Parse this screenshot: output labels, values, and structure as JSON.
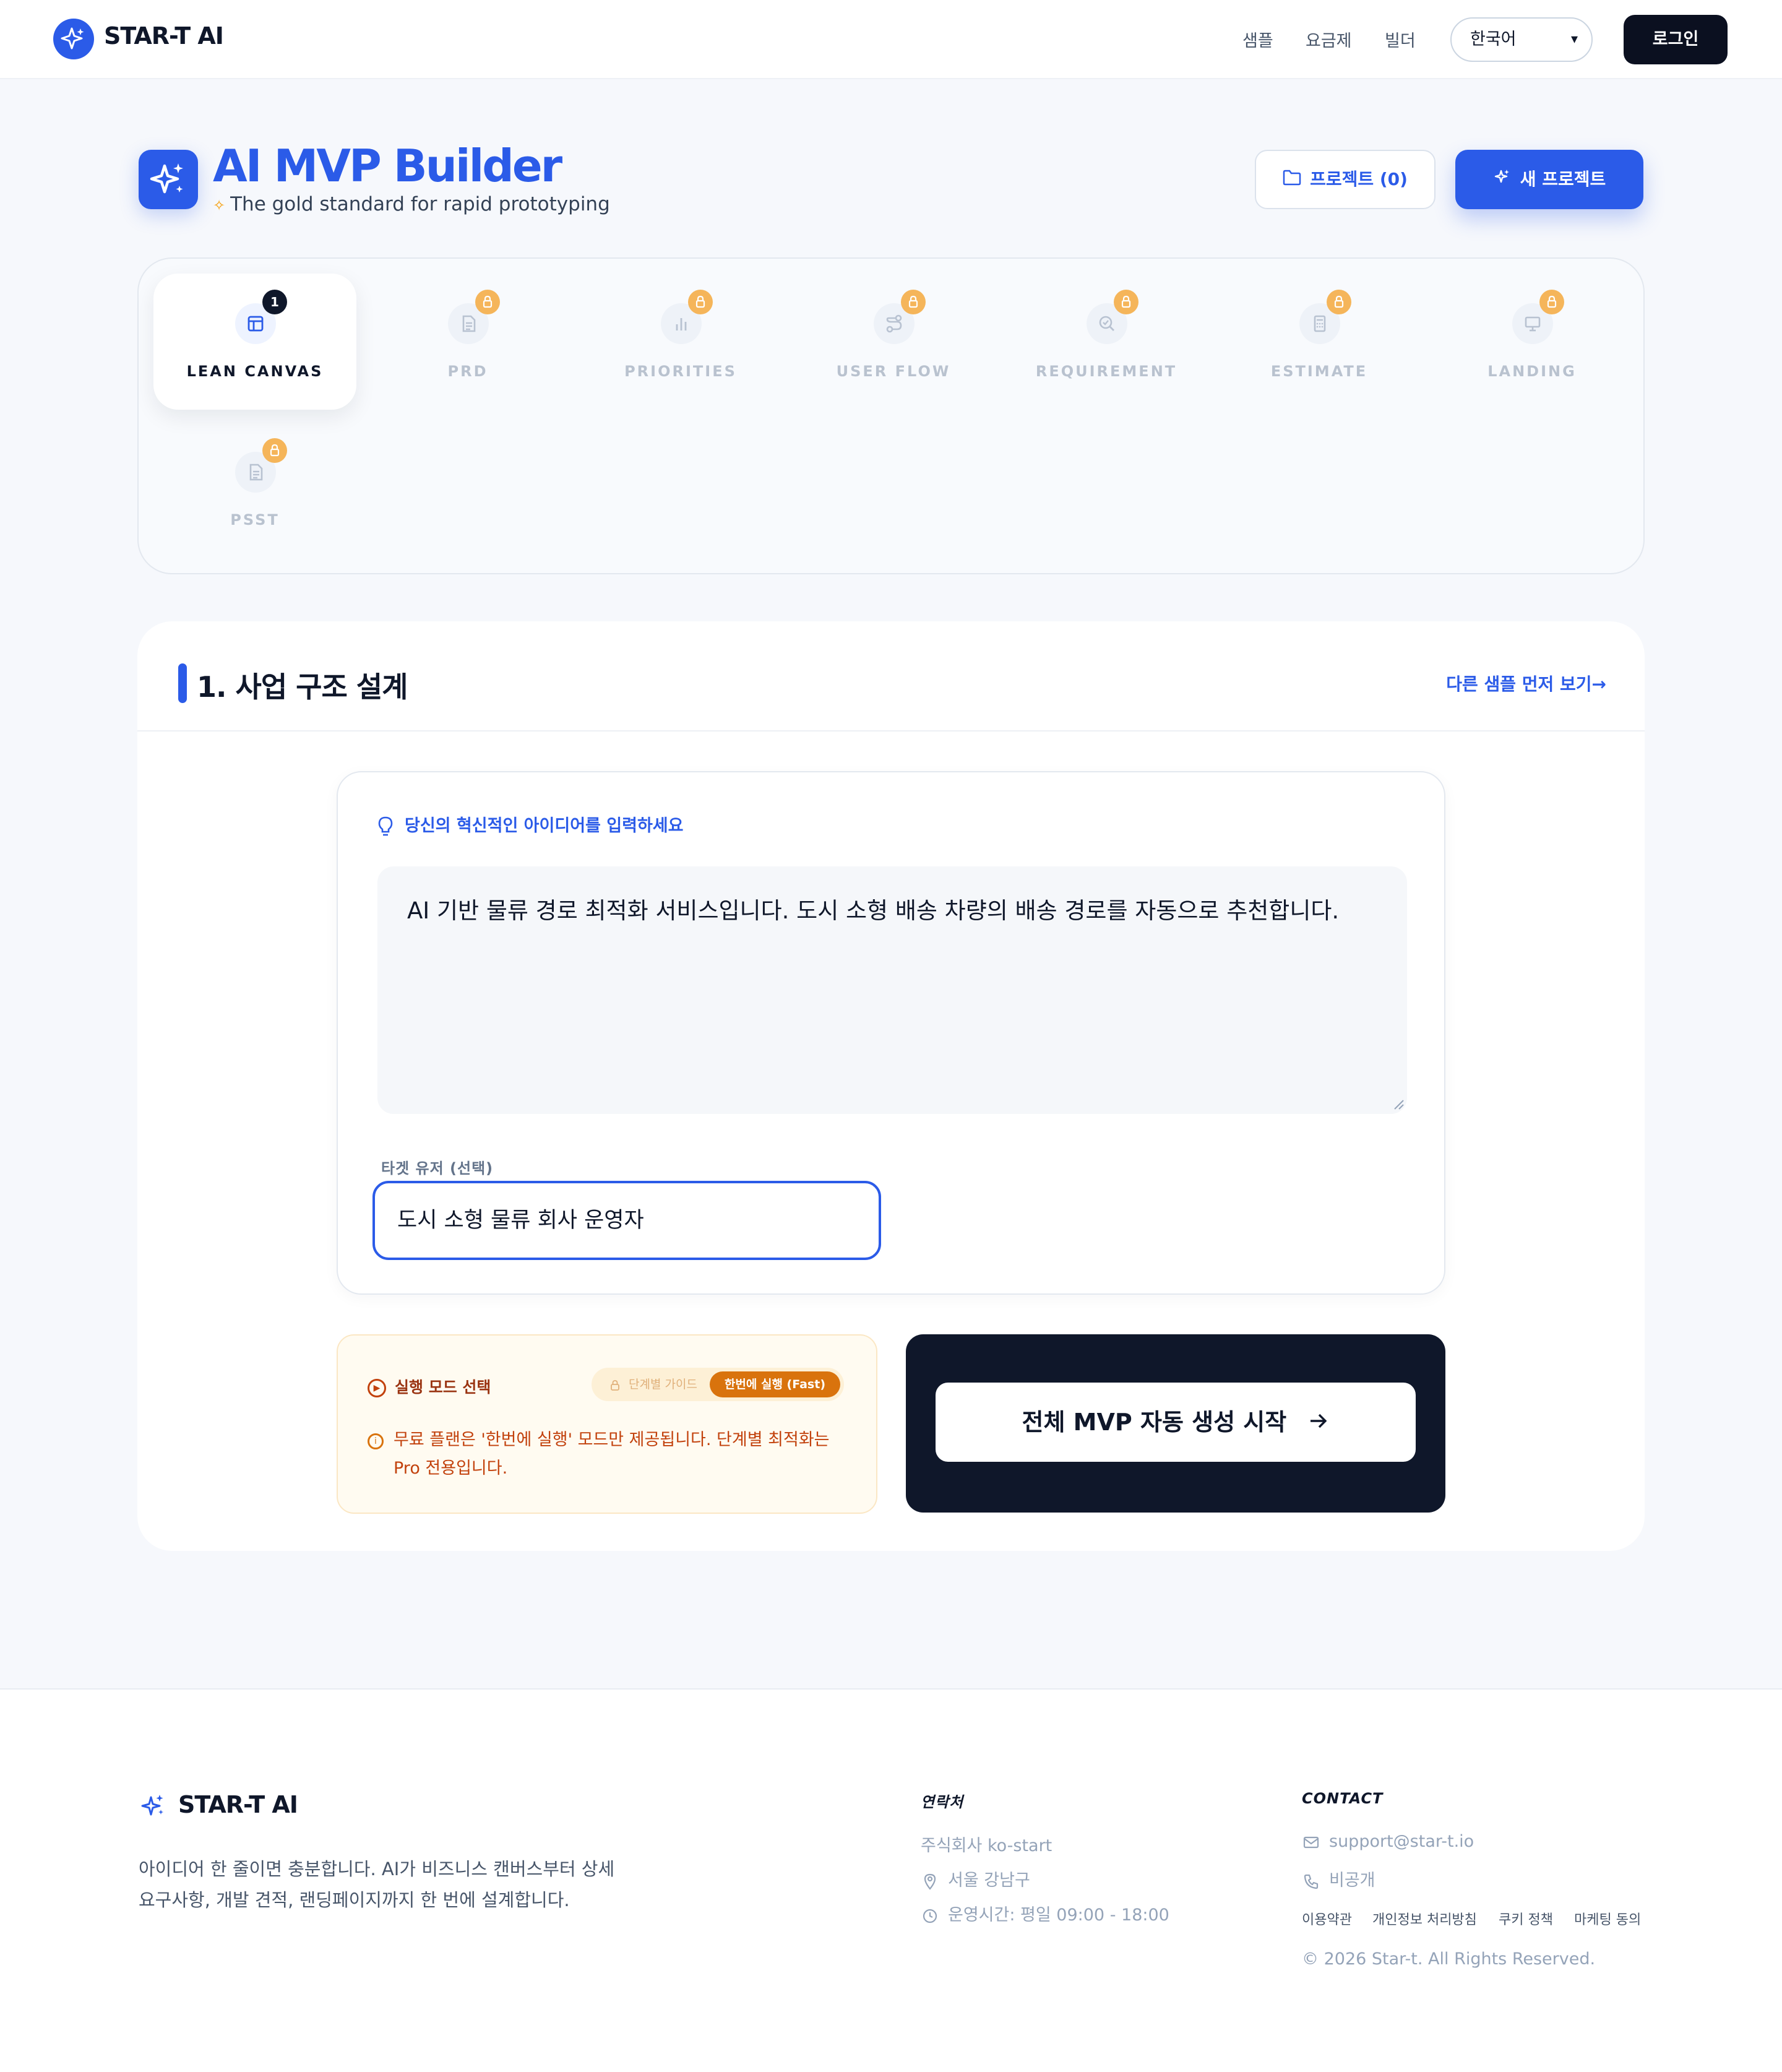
{
  "header": {
    "brand": "STAR-T AI",
    "nav": [
      "샘플",
      "요금제",
      "빌더"
    ],
    "language": "한국어",
    "login": "로그인"
  },
  "hero": {
    "title": "AI MVP Builder",
    "subtitle": "The gold standard for rapid prototyping",
    "projects_button": "프로젝트 (0)",
    "new_project_button": "새 프로젝트"
  },
  "steps": [
    {
      "label": "LEAN CANVAS",
      "badge": "1",
      "icon": "layout-icon",
      "active": true
    },
    {
      "label": "PRD",
      "badge": "lock",
      "icon": "document-icon",
      "active": false
    },
    {
      "label": "PRIORITIES",
      "badge": "lock",
      "icon": "bar-chart-icon",
      "active": false
    },
    {
      "label": "USER FLOW",
      "badge": "lock",
      "icon": "flow-icon",
      "active": false
    },
    {
      "label": "REQUIREMENT",
      "badge": "lock",
      "icon": "search-check-icon",
      "active": false
    },
    {
      "label": "ESTIMATE",
      "badge": "lock",
      "icon": "calculator-icon",
      "active": false
    },
    {
      "label": "LANDING",
      "badge": "lock",
      "icon": "monitor-icon",
      "active": false
    },
    {
      "label": "PSST",
      "badge": "lock",
      "icon": "document-icon",
      "active": false
    }
  ],
  "main": {
    "section_title": "1. 사업 구조 설계",
    "sample_link": "다른 샘플 먼저 보기→",
    "idea_label": "당신의 혁신적인 아이디어를 입력하세요",
    "idea_value": "AI 기반 물류 경로 최적화 서비스입니다. 도시 소형 배송 차량의 배송 경로를 자동으로 추천합니다.",
    "target_label": "타겟 유저 (선택)",
    "target_value": "도시 소형 물류 회사 운영자",
    "mode_title": "실행 모드 선택",
    "mode_option_guide": "단계별 가이드",
    "mode_option_fast": "한번에 실행 (Fast)",
    "mode_note": "무료 플랜은 '한번에 실행' 모드만 제공됩니다. 단계별 최적화는 Pro 전용입니다.",
    "run_button": "전체 MVP 자동 생성 시작"
  },
  "footer": {
    "brand": "STAR-T AI",
    "description": "아이디어 한 줄이면 충분합니다. AI가 비즈니스 캔버스부터 상세 요구사항, 개발 견적, 랜딩페이지까지 한 번에 설계합니다.",
    "contact_heading_kr": "연락처",
    "company": "주식회사 ko-start",
    "location": "서울 강남구",
    "hours": "운영시간: 평일 09:00 - 18:00",
    "contact_heading_en": "CONTACT",
    "email": "support@star-t.io",
    "phone": "비공개",
    "links": [
      "이용약관",
      "개인정보 처리방침",
      "쿠키 정책",
      "마케팅 동의"
    ],
    "copyright": "© 2026 Star-t. All Rights Reserved."
  },
  "colors": {
    "primary": "#2b5be8",
    "dark": "#0f172a",
    "lock": "#f5b55a",
    "warning": "#c2410c"
  }
}
